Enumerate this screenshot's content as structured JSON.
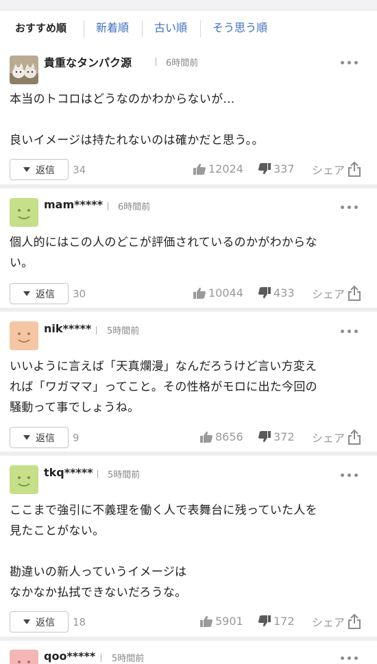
{
  "sort_tabs": [
    {
      "label": "おすすめ順",
      "active": true
    },
    {
      "label": "新着順",
      "active": false
    },
    {
      "label": "古い順",
      "active": false
    },
    {
      "label": "そう思う順",
      "active": false
    }
  ],
  "reply_label": "返信",
  "share_label": "シェア",
  "comments": [
    {
      "user": "貴重なタンパク源",
      "time": "6時間前",
      "avatar": "cats-photo",
      "lines": [
        "本当のトコロはどうなのかわからないが…",
        "",
        "良いイメージは持たれないのは確かだと思う。。"
      ],
      "replies": "34",
      "likes": "12024",
      "dislikes": "337"
    },
    {
      "user": "mam*****",
      "time": "6時間前",
      "avatar": "smiley-green",
      "lines": [
        "個人的にはこの人のどこが評価されているのかがわからな",
        "い。"
      ],
      "replies": "30",
      "likes": "10044",
      "dislikes": "433"
    },
    {
      "user": "nik*****",
      "time": "5時間前",
      "avatar": "smiley-orange",
      "lines": [
        "いいように言えば「天真爛漫」なんだろうけど言い方変え",
        "れば「ワガママ」ってこと。その性格がモロに出た今回の",
        "騒動って事でしょうね。"
      ],
      "replies": "9",
      "likes": "8656",
      "dislikes": "372"
    },
    {
      "user": "tkq*****",
      "time": "5時間前",
      "avatar": "smiley-green",
      "lines": [
        "ここまで強引に不義理を働く人で表舞台に残っていた人を",
        "見たことがない。",
        "",
        "勘違いの新人っていうイメージは",
        "なかなか払拭できないだろうな。"
      ],
      "replies": "18",
      "likes": "5901",
      "dislikes": "172"
    },
    {
      "user": "qoo*****",
      "time": "5時間前",
      "avatar": "smiley-pink"
    }
  ],
  "colors": {
    "accent_link": "#3b6fc2",
    "smiley_green": "#c5e089",
    "smiley_orange": "#f4c6a4",
    "smiley_pink": "#f4b6b6",
    "muted": "#999999"
  }
}
